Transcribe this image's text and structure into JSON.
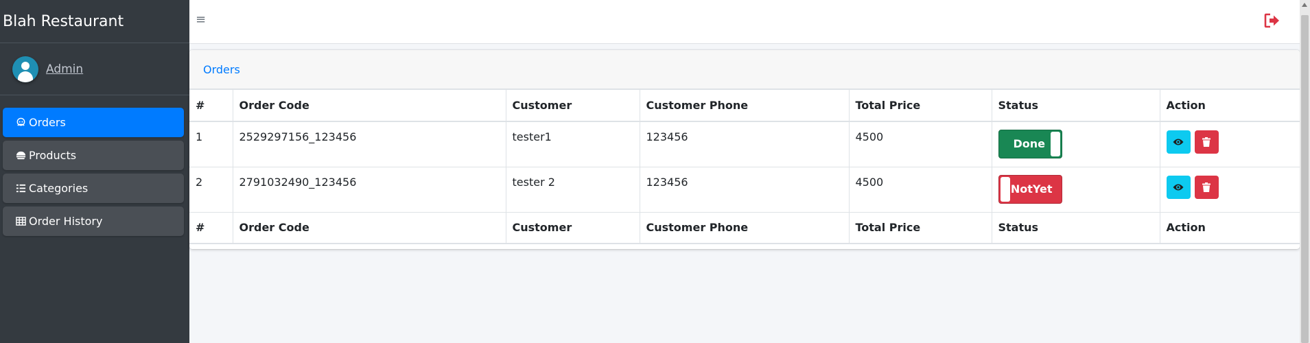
{
  "brand": {
    "title": "Blah Restaurant"
  },
  "user": {
    "name": "Admin"
  },
  "sidebar": {
    "items": [
      {
        "label": "Orders",
        "icon": "orders-icon",
        "active": true
      },
      {
        "label": "Products",
        "icon": "products-icon",
        "active": false
      },
      {
        "label": "Categories",
        "icon": "list-icon",
        "active": false
      },
      {
        "label": "Order History",
        "icon": "table-icon",
        "active": false
      }
    ]
  },
  "topbar": {
    "menu_icon": "hamburger-icon",
    "logout_icon": "sign-out-icon",
    "logout_color": "#dc3545"
  },
  "card": {
    "title": "Orders"
  },
  "table": {
    "headers": [
      "#",
      "Order Code",
      "Customer",
      "Customer Phone",
      "Total Price",
      "Status",
      "Action"
    ],
    "rows": [
      {
        "num": "1",
        "code": "2529297156_123456",
        "customer": "tester1",
        "phone": "123456",
        "total": "4500",
        "status": "Done",
        "status_on": true
      },
      {
        "num": "2",
        "code": "2791032490_123456",
        "customer": "tester 2",
        "phone": "123456",
        "total": "4500",
        "status": "NotYet",
        "status_on": false
      }
    ],
    "footers": [
      "#",
      "Order Code",
      "Customer",
      "Customer Phone",
      "Total Price",
      "Status",
      "Action"
    ]
  },
  "colors": {
    "sidebar_bg": "#343a40",
    "active": "#007bff",
    "success": "#198754",
    "danger": "#dc3545",
    "info": "#0dcaf0"
  }
}
